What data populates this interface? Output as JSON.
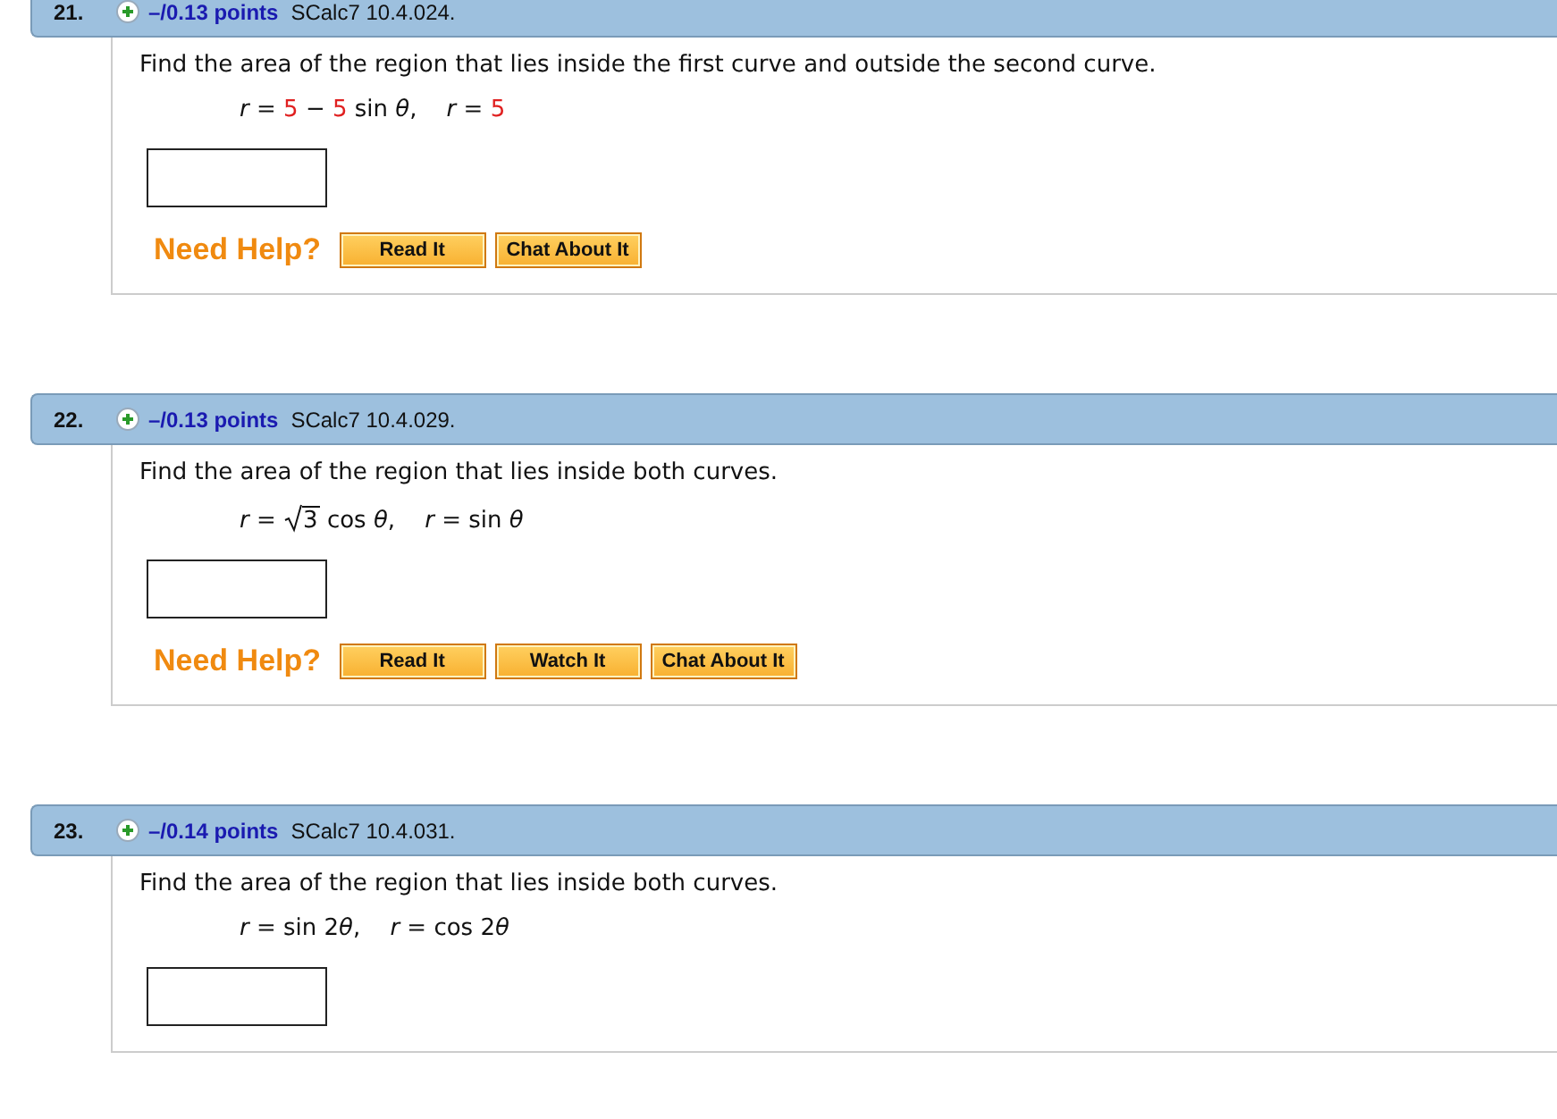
{
  "questions": [
    {
      "number": "21.",
      "points": "–/0.13 points",
      "source": "SCalc7 10.4.024.",
      "prompt": "Find the area of the region that lies inside the first curve and outside the second curve.",
      "formula": [
        {
          "kind": "plain",
          "text": "*r* = "
        },
        {
          "kind": "given",
          "text": "5"
        },
        {
          "kind": "plain",
          "text": " − "
        },
        {
          "kind": "given",
          "text": "5"
        },
        {
          "kind": "plain",
          "text": " sin *θ*,    *r* = "
        },
        {
          "kind": "given",
          "text": "5"
        }
      ],
      "help_label": "Need Help?",
      "help_buttons": [
        "Read It",
        "Chat About It"
      ]
    },
    {
      "number": "22.",
      "points": "–/0.13 points",
      "source": "SCalc7 10.4.029.",
      "prompt": "Find the area of the region that lies inside both curves.",
      "formula": [
        {
          "kind": "plain",
          "text": "*r* = "
        },
        {
          "kind": "sqrt",
          "text": "3"
        },
        {
          "kind": "plain",
          "text": " cos *θ*,    *r* = sin *θ*"
        }
      ],
      "help_label": "Need Help?",
      "help_buttons": [
        "Read It",
        "Watch It",
        "Chat About It"
      ]
    },
    {
      "number": "23.",
      "points": "–/0.14 points",
      "source": "SCalc7 10.4.031.",
      "prompt": "Find the area of the region that lies inside both curves.",
      "formula": [
        {
          "kind": "plain",
          "text": "*r* = sin 2"
        },
        {
          "kind": "plain",
          "text": "*θ*"
        },
        {
          "kind": "plain",
          "text": ",    *r* = cos 2"
        },
        {
          "kind": "plain",
          "text": "*θ*"
        }
      ]
    }
  ]
}
